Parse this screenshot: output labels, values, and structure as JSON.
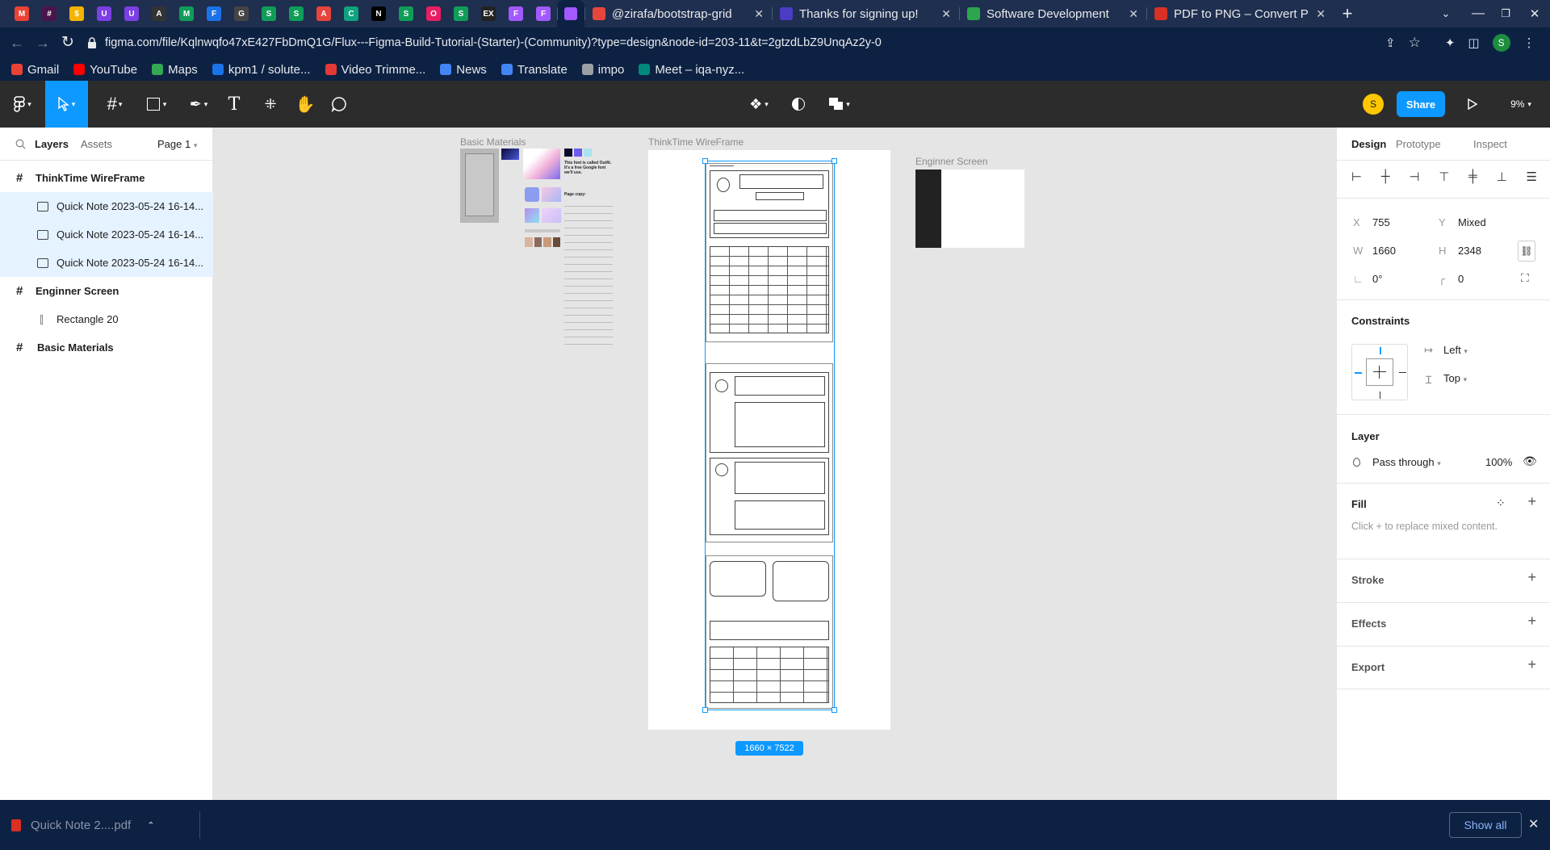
{
  "browser": {
    "tabs": [
      {
        "title": "@zirafa/bootstrap-grid",
        "favicon_color": "#e8453c"
      },
      {
        "title": "Thanks for signing up!",
        "favicon_color": "#4b3cc4"
      },
      {
        "title": "Software Development",
        "favicon_color": "#2da44e"
      },
      {
        "title": "PDF to PNG – Convert PDF",
        "favicon_color": "#d93025"
      }
    ],
    "pinned_tabs": [
      {
        "glyph": "M",
        "color": "#ea4335"
      },
      {
        "glyph": "#",
        "color": "#4a154b"
      },
      {
        "glyph": "$",
        "color": "#f4b400"
      },
      {
        "glyph": "U",
        "color": "#7b3fe4"
      },
      {
        "glyph": "U",
        "color": "#7b3fe4"
      },
      {
        "glyph": "A",
        "color": "#333333"
      },
      {
        "glyph": "M",
        "color": "#0f9d58"
      },
      {
        "glyph": "F",
        "color": "#1a73e8"
      },
      {
        "glyph": "G",
        "color": "#444444"
      },
      {
        "glyph": "S",
        "color": "#0f9d58"
      },
      {
        "glyph": "S",
        "color": "#0f9d58"
      },
      {
        "glyph": "A",
        "color": "#e8453c"
      },
      {
        "glyph": "C",
        "color": "#10a37f"
      },
      {
        "glyph": "N",
        "color": "#000000"
      },
      {
        "glyph": "S",
        "color": "#0f9d58"
      },
      {
        "glyph": "O",
        "color": "#e91e63"
      },
      {
        "glyph": "S",
        "color": "#0f9d58"
      },
      {
        "glyph": "EX",
        "color": "#222222"
      },
      {
        "glyph": "F",
        "color": "#a259ff"
      },
      {
        "glyph": "F",
        "color": "#a259ff"
      }
    ],
    "url": "figma.com/file/Kqlnwqfo47xE427FbDmQ1G/Flux---Figma-Build-Tutorial-(Starter)-(Community)?type=design&node-id=203-11&t=2gtzdLbZ9UnqAz2y-0",
    "profile_initial": "S",
    "bookmarks": [
      {
        "label": "Gmail",
        "color": "#ea4335"
      },
      {
        "label": "YouTube",
        "color": "#ff0000"
      },
      {
        "label": "Maps",
        "color": "#34a853"
      },
      {
        "label": "kpm1 / solute...",
        "color": "#1a73e8"
      },
      {
        "label": "Video Trimme...",
        "color": "#e53935"
      },
      {
        "label": "News",
        "color": "#4285f4"
      },
      {
        "label": "Translate",
        "color": "#4285f4"
      },
      {
        "label": "impo",
        "color": "#9aa0a6"
      },
      {
        "label": "Meet – iqa-nyz...",
        "color": "#00897b"
      }
    ]
  },
  "figma": {
    "user_initial": "S",
    "share_label": "Share",
    "zoom": "9%",
    "left_panel": {
      "tabs": {
        "layers": "Layers",
        "assets": "Assets",
        "page": "Page 1"
      },
      "layers": [
        {
          "name": "ThinkTime WireFrame",
          "type": "frame"
        },
        {
          "name": "Quick Note 2023-05-24 16-14...",
          "type": "image"
        },
        {
          "name": "Quick Note 2023-05-24 16-14...",
          "type": "image"
        },
        {
          "name": "Quick Note 2023-05-24 16-14...",
          "type": "image"
        },
        {
          "name": "Enginner Screen",
          "type": "frame"
        },
        {
          "name": "Rectangle 20",
          "type": "rect"
        },
        {
          "name": "Basic Materials",
          "type": "frame"
        }
      ]
    },
    "canvas": {
      "frame_labels": {
        "basic": "Basic Materials",
        "wire": "ThinkTime WireFrame",
        "engineer": "Enginner Screen"
      },
      "selection_size": "1660 × 7522",
      "font_note": "This font is called Outfit. It's a free Google font we'll use.",
      "page_copy": "Page copy:"
    },
    "right_panel": {
      "tabs": {
        "design": "Design",
        "prototype": "Prototype",
        "inspect": "Inspect"
      },
      "x_label": "X",
      "x": "755",
      "y_label": "Y",
      "y": "Mixed",
      "w_label": "W",
      "w": "1660",
      "h_label": "H",
      "h": "2348",
      "rotation": "0°",
      "radius": "0",
      "constraints_title": "Constraints",
      "constraint_h": "Left",
      "constraint_v": "Top",
      "layer_title": "Layer",
      "blend": "Pass through",
      "opacity": "100%",
      "fill_title": "Fill",
      "fill_hint": "Click + to replace mixed content.",
      "stroke_title": "Stroke",
      "effects_title": "Effects",
      "export_title": "Export"
    },
    "help": "?"
  },
  "download_bar": {
    "file": "Quick Note 2....pdf",
    "show_all": "Show all"
  }
}
